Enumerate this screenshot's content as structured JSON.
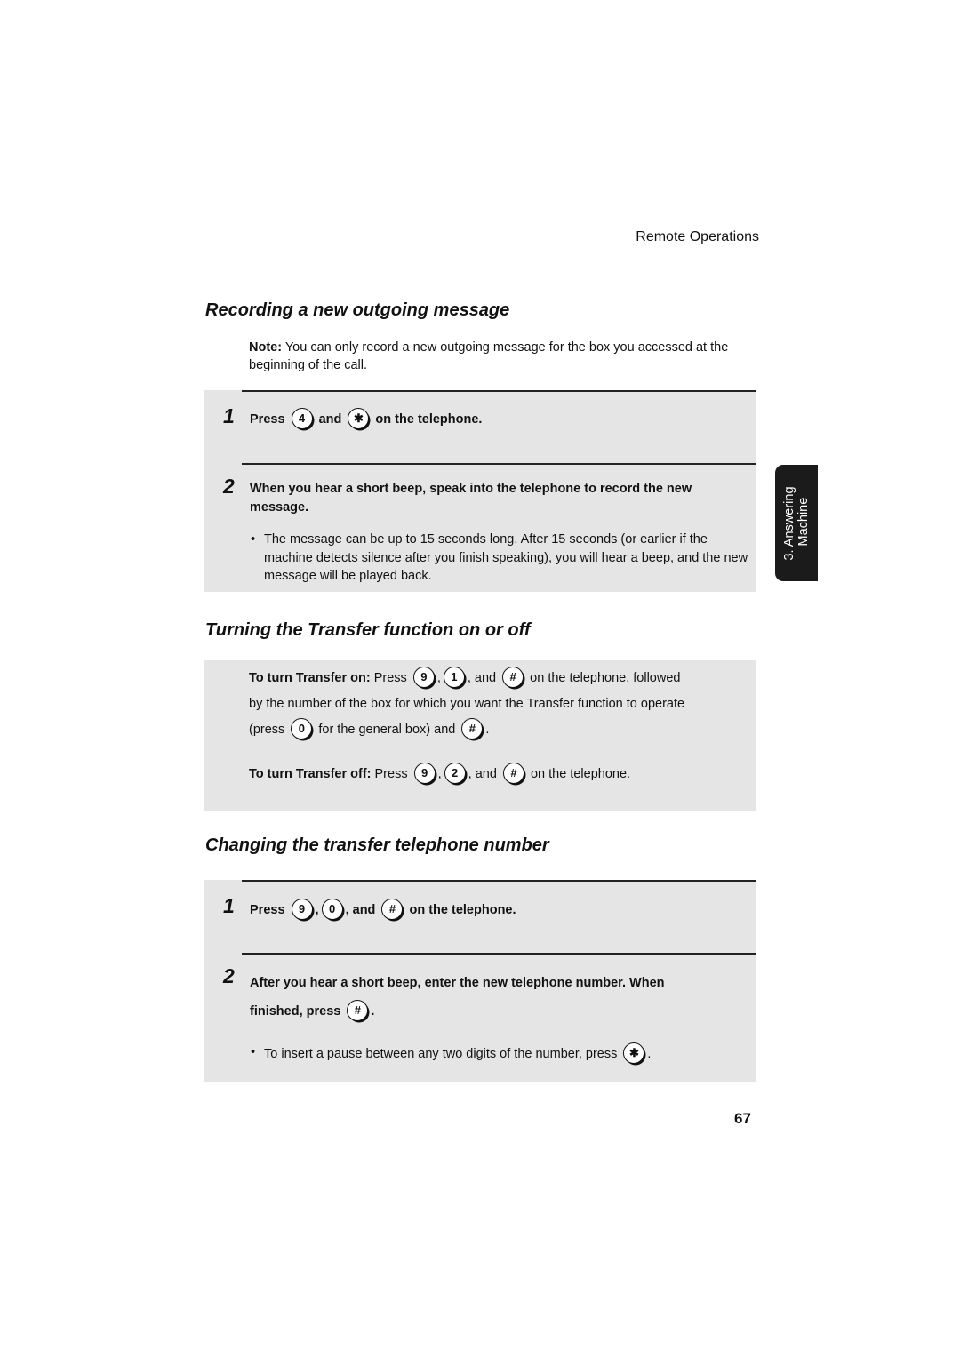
{
  "header": {
    "running_head": "Remote Operations"
  },
  "side_tab": {
    "line1": "3. Answering",
    "line2": "Machine"
  },
  "sections": {
    "recording": {
      "title": "Recording a new outgoing message",
      "note_label": "Note:",
      "note_text": " You can only record a new outgoing message for the box you accessed at the beginning of the call.",
      "step1": {
        "number": "1",
        "press": "Press",
        "key1": "4",
        "and": "and",
        "key2": "✱",
        "suffix": "on the telephone."
      },
      "step2": {
        "number": "2",
        "text": "When you hear a short beep, speak into the telephone to record the new message.",
        "bullet": "The message can be up to 15 seconds long. After 15 seconds (or earlier if the machine detects silence after you finish speaking), you will hear a beep, and the new message will be played back."
      }
    },
    "transfer": {
      "title": "Turning the Transfer function on or off",
      "on_label": "To turn Transfer on:",
      "on_press": "Press",
      "on_key1": "9",
      "on_key2": "1",
      "on_and": ", and",
      "on_key3": "#",
      "on_suffix": "on the telephone, followed",
      "on_line2": "by the number of the box for which you want the Transfer function to operate",
      "on_line3_prefix": "(press",
      "on_line3_key": "0",
      "on_line3_mid": "for the general box) and",
      "on_line3_key2": "#",
      "off_label": "To turn Transfer off:",
      "off_press": "Press",
      "off_key1": "9",
      "off_key2": "2",
      "off_and": ", and",
      "off_key3": "#",
      "off_suffix": "on the telephone."
    },
    "changing": {
      "title": "Changing the transfer telephone number",
      "step1": {
        "number": "1",
        "press": "Press",
        "key1": "9",
        "key2": "0",
        "and": ", and",
        "key3": "#",
        "suffix": "on the telephone."
      },
      "step2": {
        "number": "2",
        "line1": "After you hear a short beep, enter the new telephone number. When",
        "line2": "finished, press",
        "key": "#",
        "bullet": "To insert a pause between any two digits of the number, press",
        "bullet_key": "✱"
      }
    }
  },
  "footer": {
    "page_number": "67"
  }
}
